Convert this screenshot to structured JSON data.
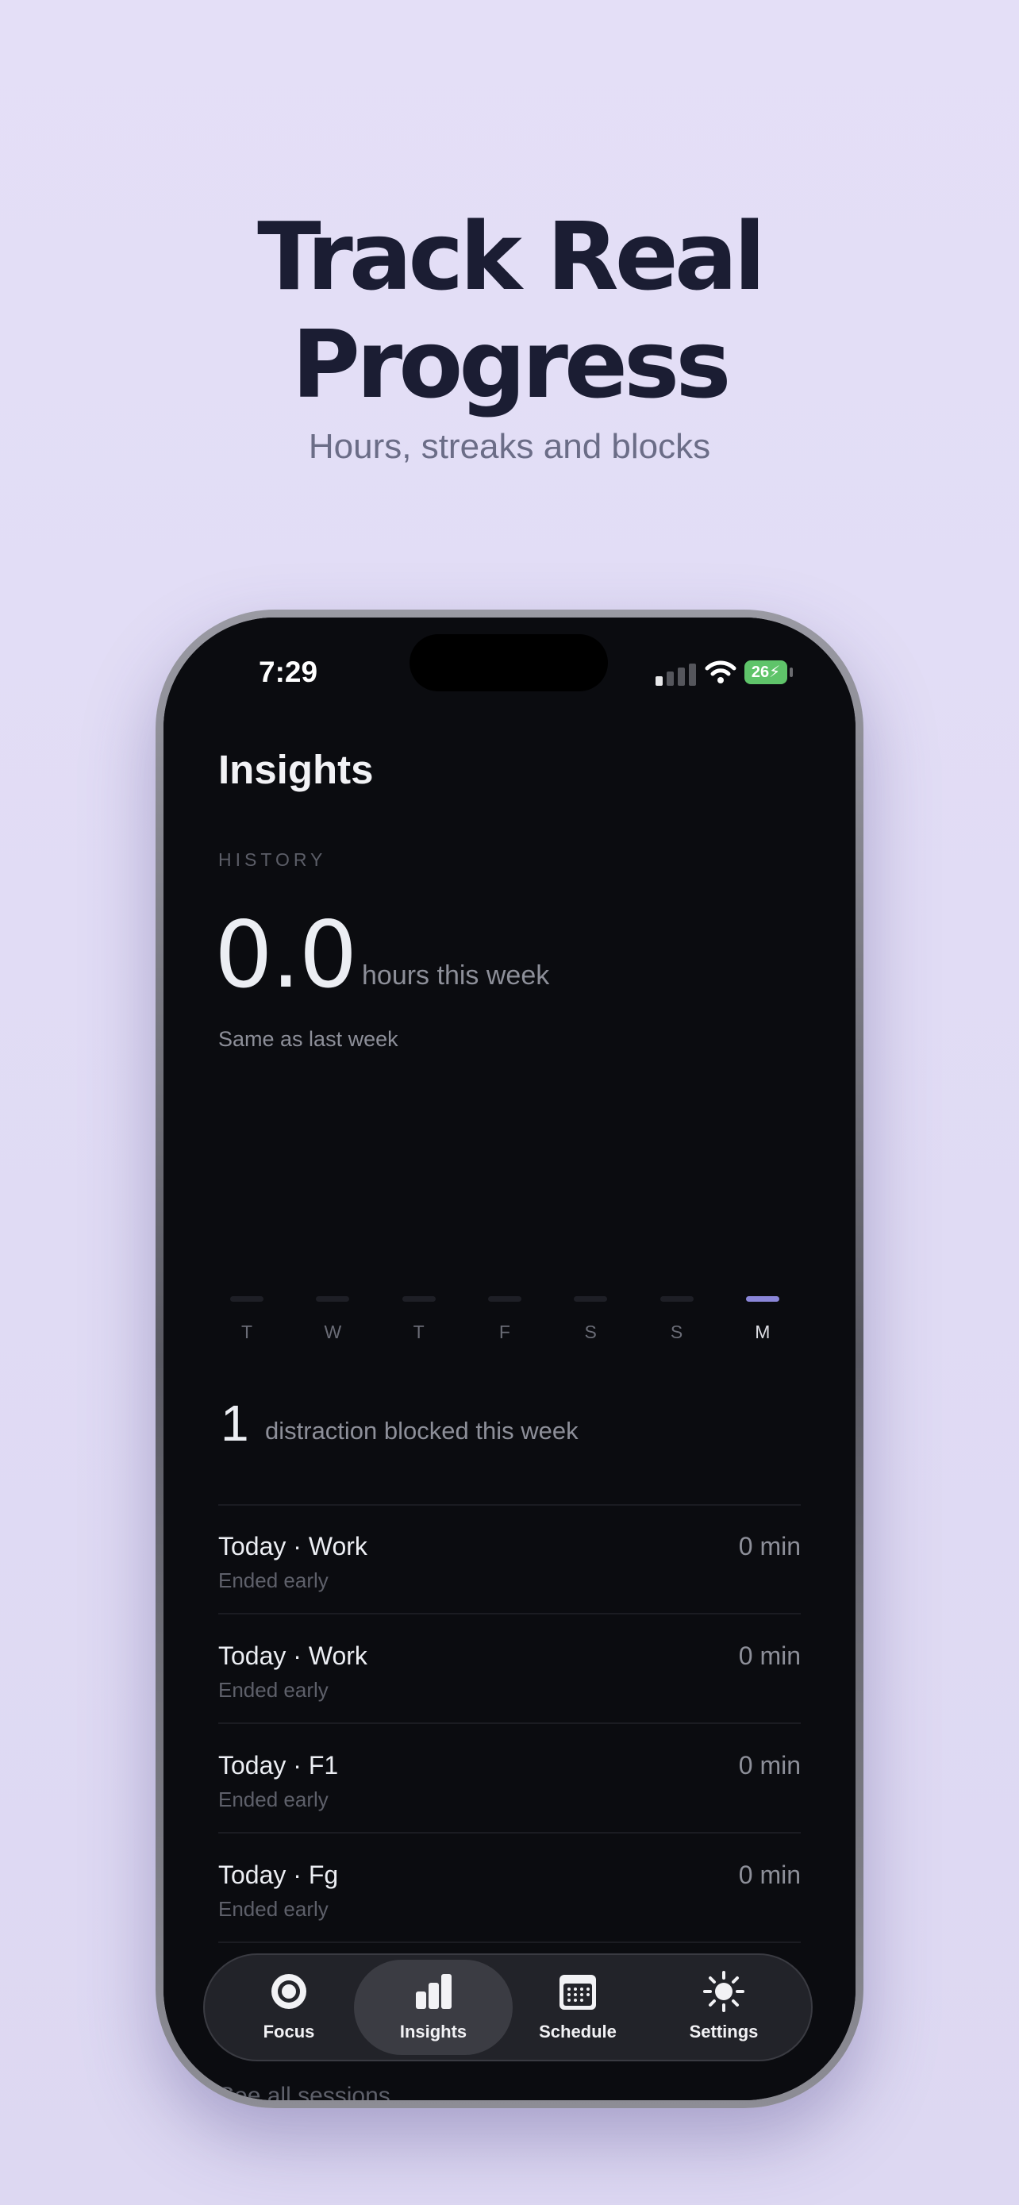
{
  "hero": {
    "headline_line1": "Track Real",
    "headline_line2": "Progress",
    "subtitle": "Hours, streaks and blocks"
  },
  "status_bar": {
    "time": "7:29",
    "battery": "26"
  },
  "screen": {
    "title": "Insights",
    "section_label": "HISTORY",
    "hours_value": "0.0",
    "hours_unit": "hours this week",
    "comparison": "Same as last week"
  },
  "chart_data": {
    "type": "bar",
    "categories": [
      "T",
      "W",
      "T",
      "F",
      "S",
      "S",
      "M"
    ],
    "values": [
      0,
      0,
      0,
      0,
      0,
      0,
      0
    ],
    "highlighted_category_index": 6,
    "bar_color": "#1e1f26",
    "highlight_color": "#8a86d8"
  },
  "blocked": {
    "count": "1",
    "text": "distraction blocked this week"
  },
  "sessions": [
    {
      "title": "Today · Work",
      "status": "Ended early",
      "duration": "0 min"
    },
    {
      "title": "Today · Work",
      "status": "Ended early",
      "duration": "0 min"
    },
    {
      "title": "Today · F1",
      "status": "Ended early",
      "duration": "0 min"
    },
    {
      "title": "Today · Fg",
      "status": "Ended early",
      "duration": "0 min"
    }
  ],
  "see_all": "See all sessions",
  "tabs": [
    {
      "label": "Focus",
      "icon": "focus-ring-icon"
    },
    {
      "label": "Insights",
      "icon": "bar-chart-icon",
      "active": true
    },
    {
      "label": "Schedule",
      "icon": "calendar-icon"
    },
    {
      "label": "Settings",
      "icon": "sun-icon"
    }
  ],
  "colors": {
    "background": "#e4dff7",
    "headline": "#1b1d33",
    "app_background": "#0b0c10",
    "accent": "#8a86d8"
  }
}
